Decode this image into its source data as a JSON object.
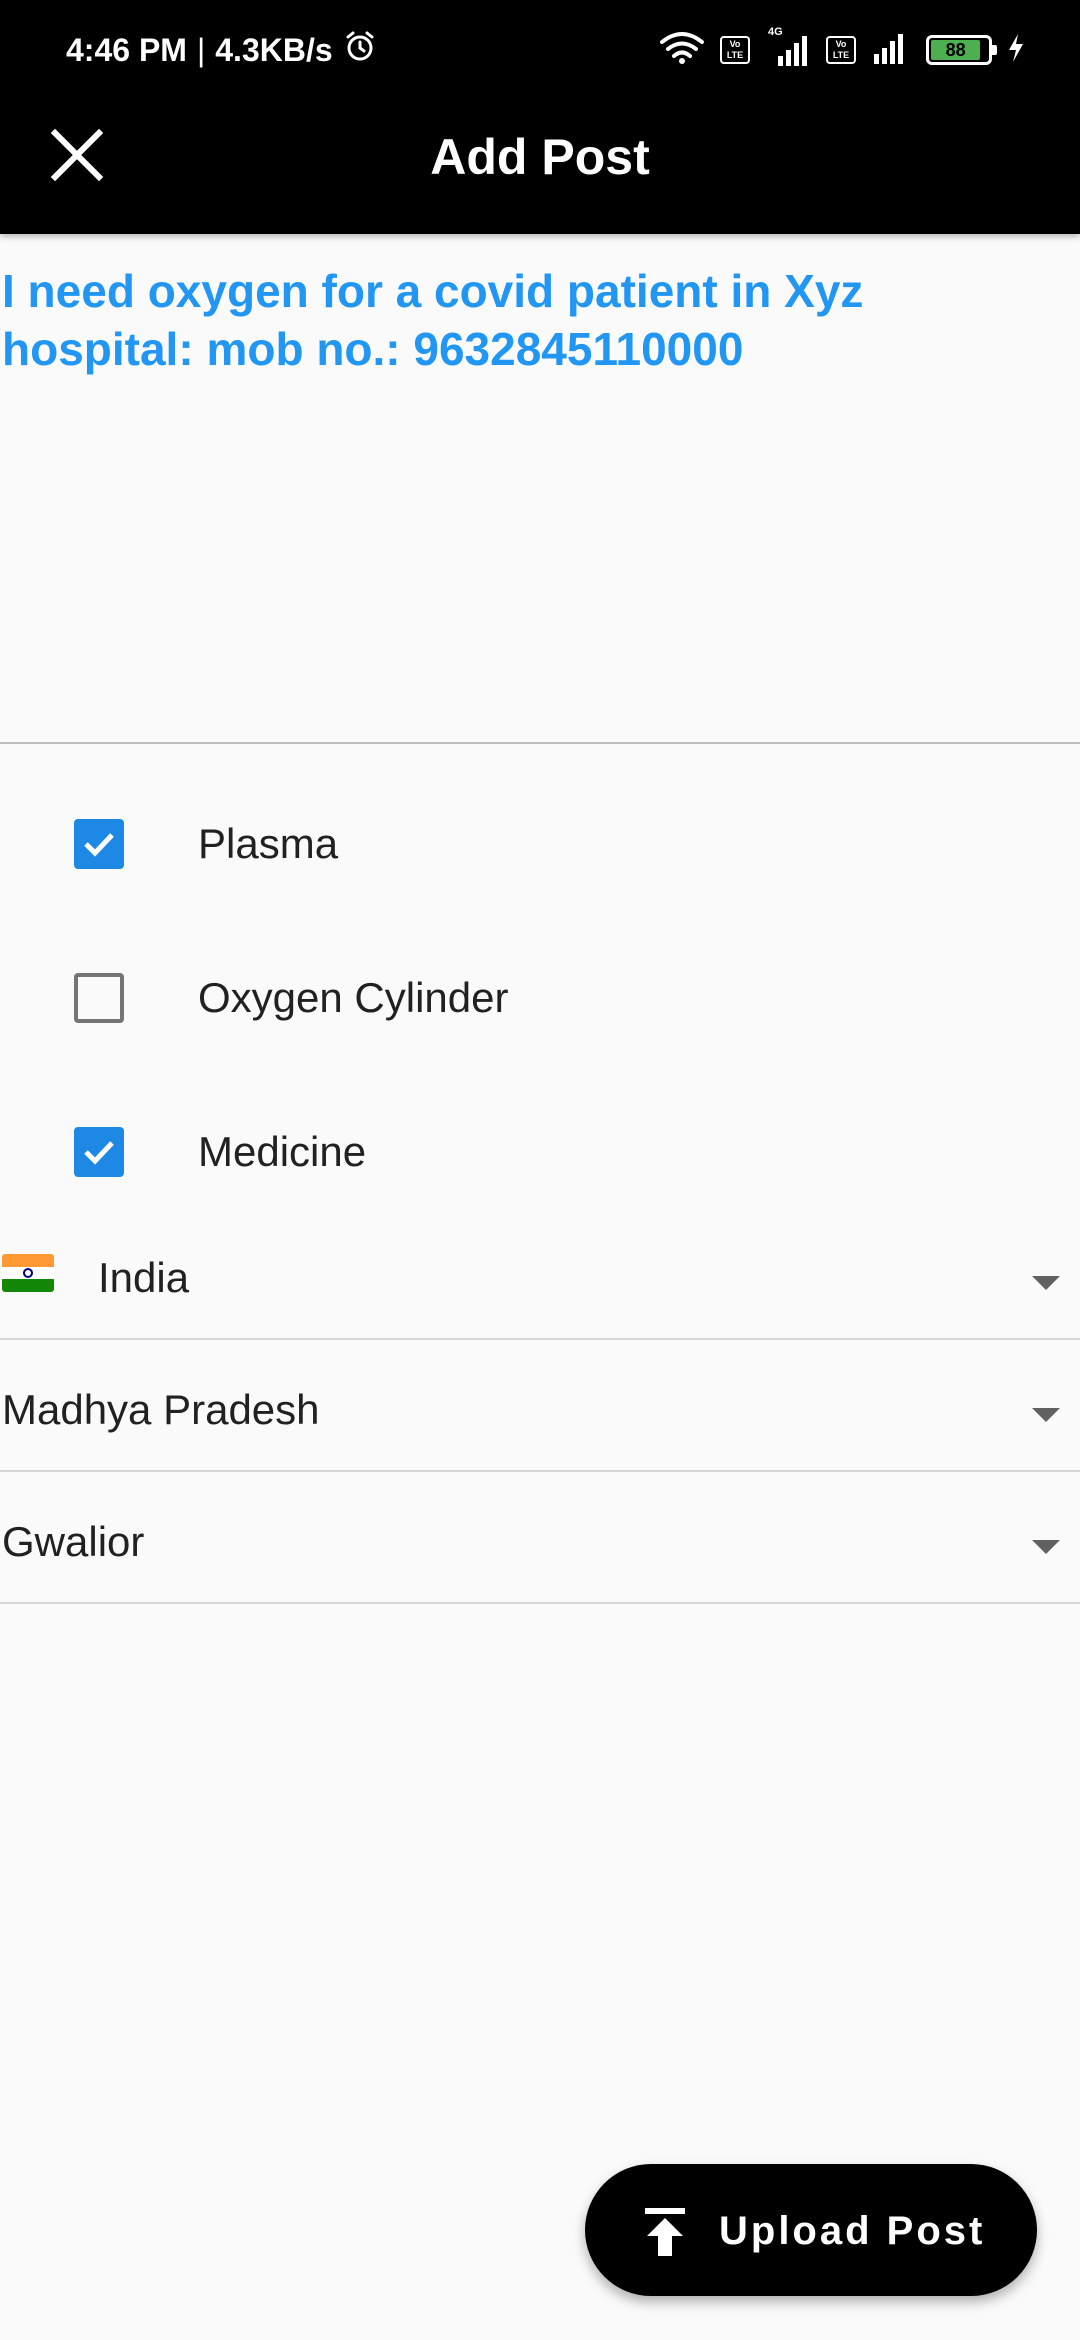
{
  "status_bar": {
    "time": "4:46 PM",
    "speed": "4.3KB/s",
    "network_4g": "4G",
    "volte_1": "Vo LTE",
    "volte_2": "Vo LTE",
    "battery": "88",
    "battery_level_percent": 88
  },
  "app_bar": {
    "title": "Add Post",
    "close_icon": "close-icon"
  },
  "post": {
    "line1": "I need oxygen for a covid patient in Xyz",
    "line2": "hospital: mob no.: 9632845110000",
    "text_color": "#2196f3"
  },
  "options": [
    {
      "label": "Plasma",
      "checked": true
    },
    {
      "label": "Oxygen Cylinder",
      "checked": false
    },
    {
      "label": "Medicine",
      "checked": true
    }
  ],
  "location": {
    "country": "India",
    "state": "Madhya Pradesh",
    "city": "Gwalior"
  },
  "upload_button": {
    "label": "Upload Post",
    "icon": "upload-icon"
  },
  "colors": {
    "accent": "#1e88e5",
    "app_bar": "#000000",
    "background": "#fafafa"
  }
}
